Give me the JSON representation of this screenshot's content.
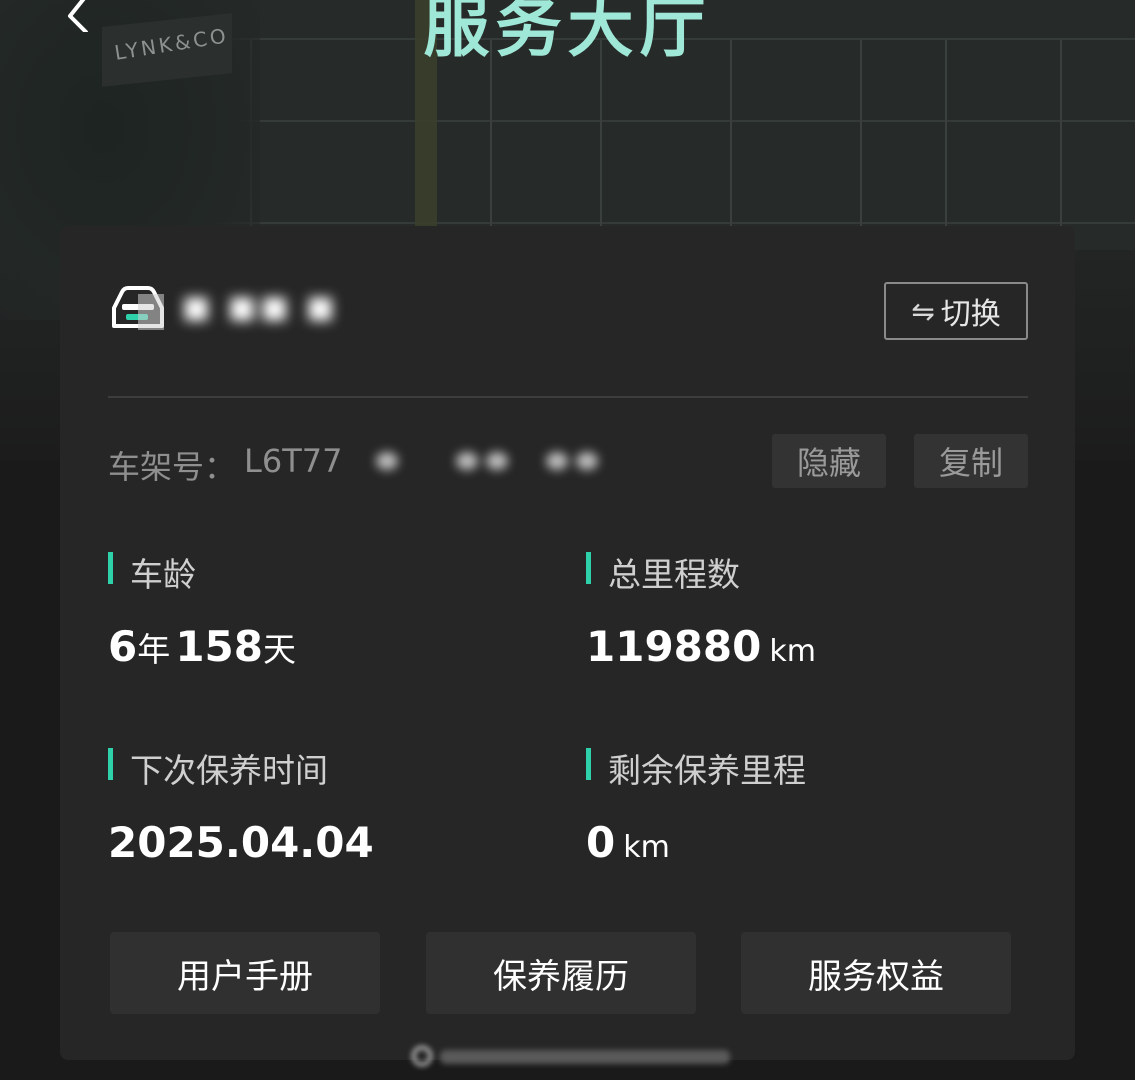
{
  "header": {
    "title": "服务大厅",
    "back_icon": "chevron-left-icon",
    "background_sign": "LYNK&CO"
  },
  "vehicle": {
    "icon": "car-icon",
    "name_blurred": "■ ■■ ■",
    "switch_icon": "⇋",
    "switch_label": "切换"
  },
  "vin": {
    "label": "车架号：",
    "value_visible": "L6T77",
    "hide_label": "隐藏",
    "copy_label": "复制"
  },
  "stats": {
    "age": {
      "label": "车龄",
      "years": "6",
      "years_unit": "年",
      "days": "158",
      "days_unit": "天"
    },
    "mileage": {
      "label": "总里程数",
      "value": "119880",
      "unit": "km"
    },
    "next_maintenance": {
      "label": "下次保养时间",
      "value": "2025.04.04"
    },
    "remaining_maintenance": {
      "label": "剩余保养里程",
      "value": "0",
      "unit": "km"
    }
  },
  "actions": {
    "manual": "用户手册",
    "history": "保养履历",
    "benefits": "服务权益"
  },
  "colors": {
    "accent": "#2fd1aa",
    "title": "#9fe7d6",
    "card": "#262626",
    "button": "#303030"
  }
}
